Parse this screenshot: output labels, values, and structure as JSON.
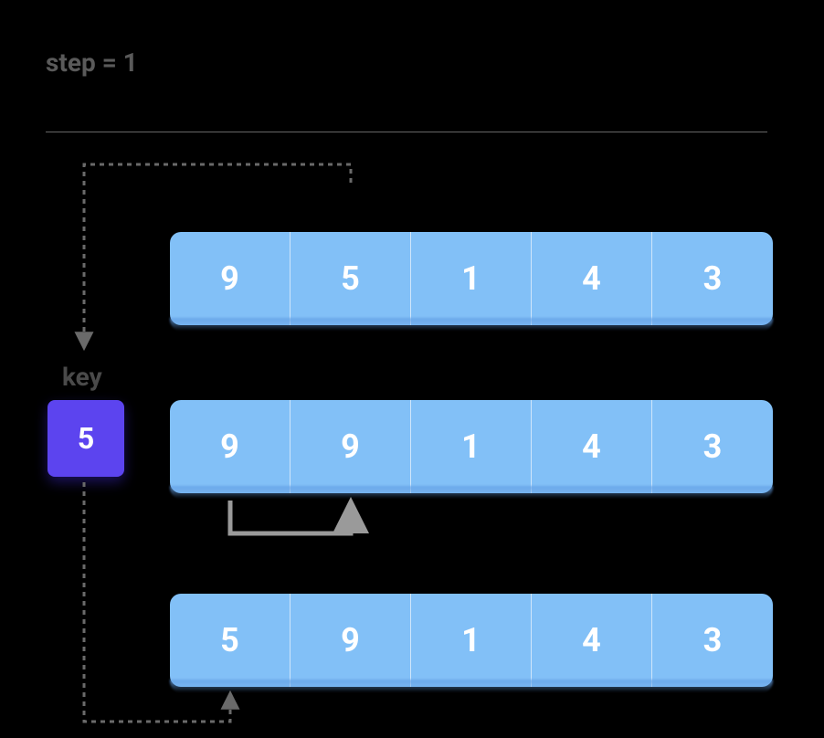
{
  "step_label": "step = 1",
  "key_label": "key",
  "key_value": "5",
  "arrays": {
    "row1": [
      "9",
      "5",
      "1",
      "4",
      "3"
    ],
    "row2": [
      "9",
      "9",
      "1",
      "4",
      "3"
    ],
    "row3": [
      "5",
      "9",
      "1",
      "4",
      "3"
    ]
  }
}
